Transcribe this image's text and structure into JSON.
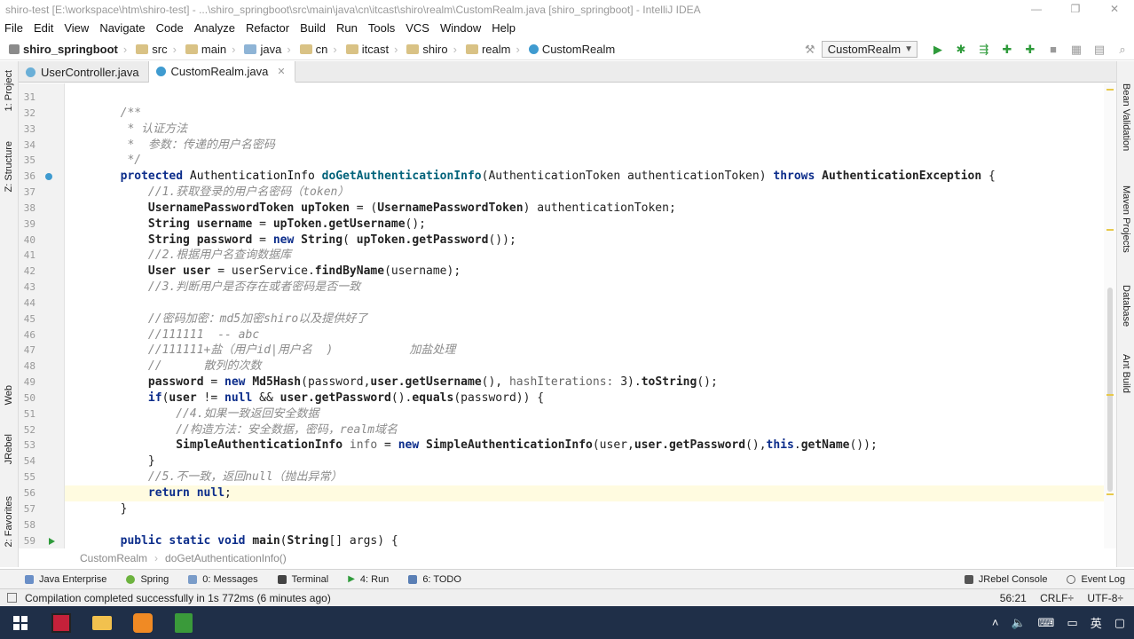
{
  "window": {
    "title": "shiro-test [E:\\workspace\\htm\\shiro-test] - ...\\shiro_springboot\\src\\main\\java\\cn\\itcast\\shiro\\realm\\CustomRealm.java [shiro_springboot] - IntelliJ IDEA"
  },
  "menu": [
    "File",
    "Edit",
    "View",
    "Navigate",
    "Code",
    "Analyze",
    "Refactor",
    "Build",
    "Run",
    "Tools",
    "VCS",
    "Window",
    "Help"
  ],
  "breadcrumb": [
    "shiro_springboot",
    "src",
    "main",
    "java",
    "cn",
    "itcast",
    "shiro",
    "realm",
    "CustomRealm"
  ],
  "run_config": "CustomRealm",
  "left_tools": [
    "1: Project",
    "Z: Structure",
    "Web",
    "JRebel",
    "2: Favorites"
  ],
  "right_tools": [
    "Bean Validation",
    "Maven Projects",
    "Database",
    "Ant Build"
  ],
  "tabs": [
    {
      "label": "UserController.java",
      "active": false
    },
    {
      "label": "CustomRealm.java",
      "active": true
    }
  ],
  "code": {
    "lines": [
      {
        "n": "31",
        "html": ""
      },
      {
        "n": "32",
        "html": "        <span class=\"cm\">/**</span>"
      },
      {
        "n": "33",
        "html": "<span class=\"cm\">         * 认证方法</span>"
      },
      {
        "n": "34",
        "html": "<span class=\"cm\">         *  参数：传递的用户名密码</span>"
      },
      {
        "n": "35",
        "html": "<span class=\"cm\">         */</span>"
      },
      {
        "n": "36",
        "html": "        <span class=\"kw\">protected</span> <span class=\"txt\">AuthenticationInfo</span> <span class=\"fn\"><b>doGetAuthenticationInfo</b></span>(AuthenticationToken authenticationToken) <span class=\"kw\">throws</span> <b>AuthenticationException</b> {"
      },
      {
        "n": "37",
        "html": "            <span class=\"cm\">//1.获取登录的用户名密码（token）</span>"
      },
      {
        "n": "38",
        "html": "            <b>UsernamePasswordToken upToken</b> = (<b>UsernamePasswordToken</b>) authenticationToken;"
      },
      {
        "n": "39",
        "html": "            <b>String username</b> = <b>upToken.getUsername</b>();"
      },
      {
        "n": "40",
        "html": "            <b>String password</b> = <span class=\"kw\">new</span> <b>String</b>( <b>upToken.getPassword</b>());"
      },
      {
        "n": "41",
        "html": "            <span class=\"cm\">//2.根据用户名查询数据库</span>"
      },
      {
        "n": "42",
        "html": "            <b>User user</b> = userService.<b>findByName</b>(username);"
      },
      {
        "n": "43",
        "html": "            <span class=\"cm\">//3.判断用户是否存在或者密码是否一致</span>"
      },
      {
        "n": "44",
        "html": ""
      },
      {
        "n": "45",
        "html": "            <span class=\"cm\">//密码加密：md5加密shiro以及提供好了</span>"
      },
      {
        "n": "46",
        "html": "            <span class=\"cm\">//111111  -- abc</span>"
      },
      {
        "n": "47",
        "html": "            <span class=\"cm\">//111111+盐（用户id|用户名  )           加盐处理</span>"
      },
      {
        "n": "48",
        "html": "            <span class=\"cm\">//      散列的次数</span>"
      },
      {
        "n": "49",
        "html": "            <b>password</b> = <span class=\"kw\">new</span> <b>Md5Hash</b>(password,<b>user.getUsername</b>(), <span class=\"param\">hashIterations:</span> 3).<b>toString</b>();"
      },
      {
        "n": "50",
        "html": "            <span class=\"kw\">if</span>(<b>user</b> != <span class=\"kw\">null</span> &amp;&amp; <b>user.getPassword</b>().<b>equals</b>(password)) {"
      },
      {
        "n": "51",
        "html": "                <span class=\"cm\">//4.如果一致返回安全数据</span>"
      },
      {
        "n": "52",
        "html": "                <span class=\"cm\">//构造方法：安全数据，密码，realm域名</span>"
      },
      {
        "n": "53",
        "html": "                <b>SimpleAuthenticationInfo</b> <span class=\"param\">info</span> = <span class=\"kw\">new</span> <b>SimpleAuthenticationInfo</b>(user,<b>user.getPassword</b>(),<span class=\"kw\">this</span>.<b>getName</b>());"
      },
      {
        "n": "54",
        "html": "            }"
      },
      {
        "n": "55",
        "html": "            <span class=\"cm\">//5.不一致，返回null（抛出异常）</span>"
      },
      {
        "n": "56",
        "html": "            <span class=\"kw\">return null</span>;"
      },
      {
        "n": "57",
        "html": "        }"
      },
      {
        "n": "58",
        "html": ""
      },
      {
        "n": "59",
        "html": "        <span class=\"kw\">public static void</span> <b>main</b>(<b>String</b>[] args) {"
      }
    ]
  },
  "code_crumbs": [
    "CustomRealm",
    "doGetAuthenticationInfo()"
  ],
  "tool_windows": [
    {
      "label": "Java Enterprise",
      "color": "#6a8fc7"
    },
    {
      "label": "Spring",
      "color": "#6db33f"
    },
    {
      "label": "0: Messages",
      "color": "#7a9cc9"
    },
    {
      "label": "Terminal",
      "color": "#444444"
    },
    {
      "label": "4: Run",
      "color": "#2f9b3b"
    },
    {
      "label": "6: TODO",
      "color": "#5a7fb5"
    }
  ],
  "tool_windows_right": [
    "JRebel Console",
    "Event Log"
  ],
  "status": {
    "message": "Compilation completed successfully in 1s 772ms (6 minutes ago)",
    "position": "56:21",
    "line_sep": "CRLF÷",
    "encoding": "UTF-8÷"
  },
  "tray": {
    "ime": "英"
  }
}
